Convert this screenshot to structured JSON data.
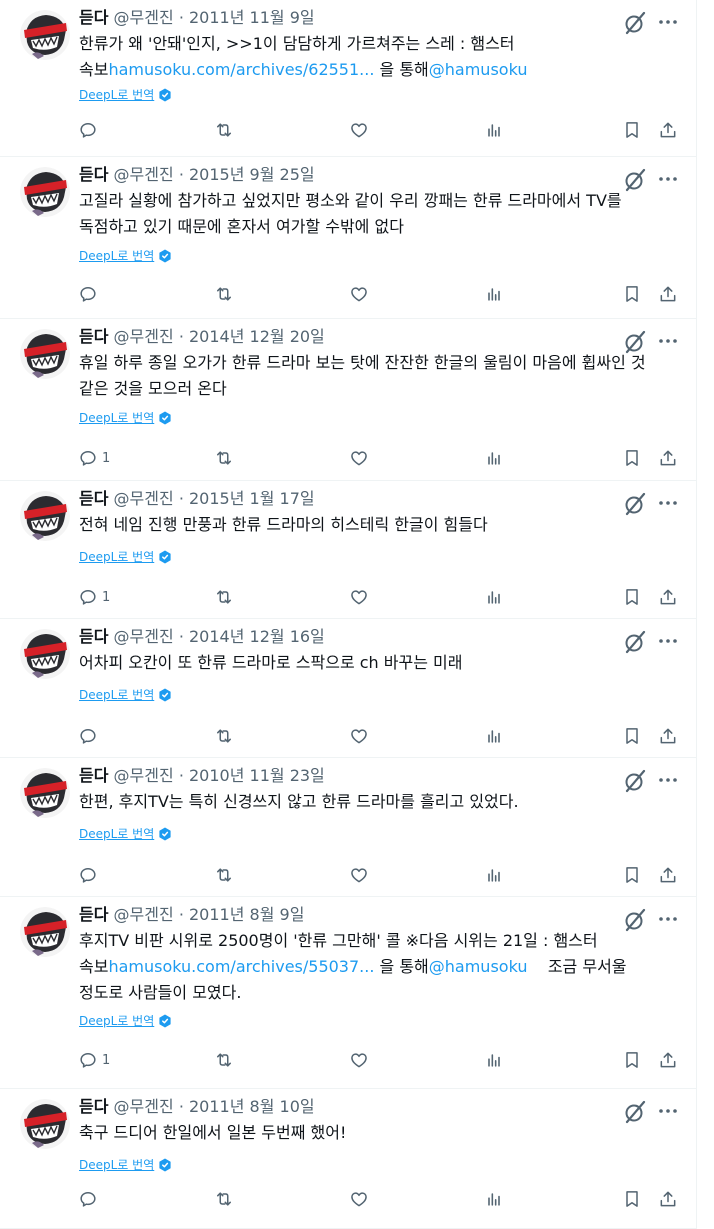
{
  "colors": {
    "accent": "#1d9bf0",
    "text": "#0f1419",
    "muted": "#536471",
    "border": "#eff3f4"
  },
  "icons": {
    "reply": "reply-icon",
    "retweet": "retweet-icon",
    "like": "like-icon",
    "views": "views-icon",
    "bookmark": "bookmark-icon",
    "share": "share-icon",
    "grok": "grok-icon",
    "more": "more-icon",
    "deepl": "deepl-badge-icon"
  },
  "tweets": [
    {
      "name": "듣다",
      "handle": "@무겐진",
      "sep": "·",
      "date": "2011년 11월 9일",
      "text_before": "한류가 왜 '안돼'인지, >>1이 담담하게 가르쳐주는 스레 : 햄스터 속보",
      "link": "hamusoku.com/archives/62551...",
      "text_mid": " 을 통해",
      "mention": "@hamusoku",
      "text_after": "",
      "translate": "DeepL로 번역",
      "reply_count": ""
    },
    {
      "name": "듣다",
      "handle": "@무겐진",
      "sep": "·",
      "date": "2015년 9월 25일",
      "text_before": "고질라 실황에 참가하고 싶었지만 평소와 같이 우리 깡패는 한류 드라마에서 TV를 독점하고 있기 때문에 혼자서 여가할 수밖에 없다",
      "link": "",
      "text_mid": "",
      "mention": "",
      "text_after": "",
      "translate": "DeepL로 번역",
      "reply_count": ""
    },
    {
      "name": "듣다",
      "handle": "@무겐진",
      "sep": "·",
      "date": "2014년 12월 20일",
      "text_before": "휴일 하루 종일 오가가 한류 드라마 보는 탓에 잔잔한 한글의 울림이 마음에 휩싸인 것 같은 것을 모으러 온다",
      "link": "",
      "text_mid": "",
      "mention": "",
      "text_after": "",
      "translate": "DeepL로 번역",
      "reply_count": "1"
    },
    {
      "name": "듣다",
      "handle": "@무겐진",
      "sep": "·",
      "date": "2015년 1월 17일",
      "text_before": "전혀 네임 진행 만풍과 한류 드라마의 히스테릭 한글이 힘들다",
      "link": "",
      "text_mid": "",
      "mention": "",
      "text_after": "",
      "translate": "DeepL로 번역",
      "reply_count": "1"
    },
    {
      "name": "듣다",
      "handle": "@무겐진",
      "sep": "·",
      "date": "2014년 12월 16일",
      "text_before": "어차피 오칸이 또 한류 드라마로 스팍으로 ch 바꾸는 미래",
      "link": "",
      "text_mid": "",
      "mention": "",
      "text_after": "",
      "translate": "DeepL로 번역",
      "reply_count": ""
    },
    {
      "name": "듣다",
      "handle": "@무겐진",
      "sep": "·",
      "date": "2010년 11월 23일",
      "text_before": "한편, 후지TV는 특히 신경쓰지 않고 한류 드라마를 흘리고 있었다.",
      "link": "",
      "text_mid": "",
      "mention": "",
      "text_after": "",
      "translate": "DeepL로 번역",
      "reply_count": ""
    },
    {
      "name": "듣다",
      "handle": "@무겐진",
      "sep": "·",
      "date": "2011년 8월 9일",
      "text_before": "후지TV 비판 시위로 2500명이 '한류 그만해' 콜 ※다음 시위는 21일 : 햄스터 속보",
      "link": "hamusoku.com/archives/55037...",
      "text_mid": " 을 통해",
      "mention": "@hamusoku",
      "text_after": "    조금 무서울 정도로 사람들이 모였다.",
      "translate": "DeepL로 번역",
      "reply_count": "1"
    },
    {
      "name": "듣다",
      "handle": "@무겐진",
      "sep": "·",
      "date": "2011년 8월 10일",
      "text_before": "축구 드디어 한일에서 일본 두번째 했어!",
      "link": "",
      "text_mid": "",
      "mention": "",
      "text_after": "",
      "translate": "DeepL로 번역",
      "reply_count": ""
    }
  ]
}
